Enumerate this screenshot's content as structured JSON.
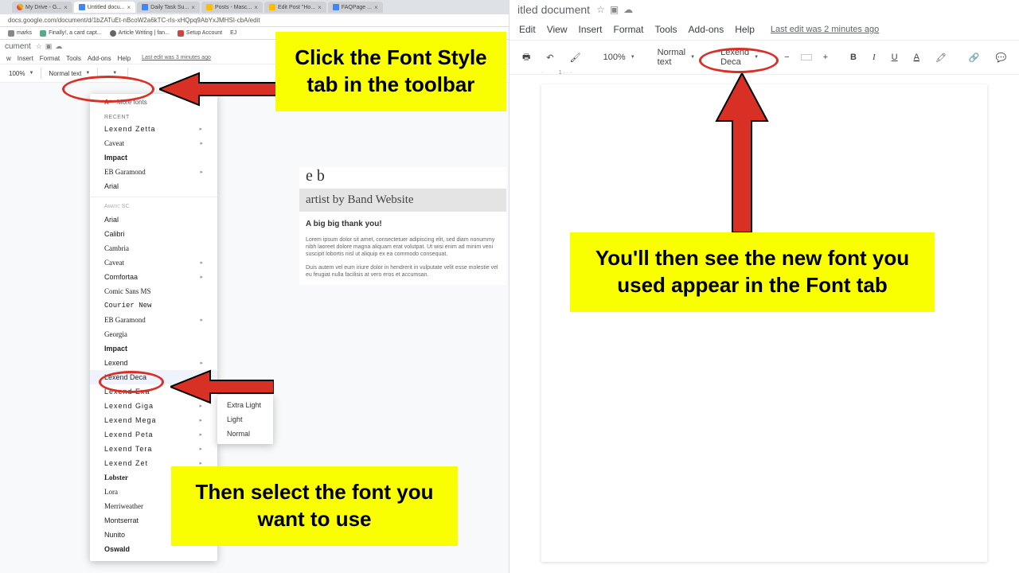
{
  "browser": {
    "tabs": [
      {
        "label": "My Drive - G..."
      },
      {
        "label": "Untitled docu..."
      },
      {
        "label": "Daily Task Su..."
      },
      {
        "label": "Posts - Masc..."
      },
      {
        "label": "Edit Post \"Ho..."
      },
      {
        "label": "FAQPage ..."
      }
    ],
    "url": "docs.google.com/document/d/1bZATuEt-nBcoW2a6kTC-rIs-xHQpq9AbYxJMHSI-cbA/edit",
    "bookmarks": [
      {
        "label": "marks"
      },
      {
        "label": "Finally!, a card capt..."
      },
      {
        "label": "Article Writing | fan..."
      },
      {
        "label": "Setup Account"
      }
    ]
  },
  "left_doc": {
    "title": "cument",
    "menus": [
      "w",
      "Insert",
      "Format",
      "Tools",
      "Add-ons",
      "Help"
    ],
    "last_edit": "Last edit was 3 minutes ago",
    "zoom": "100%",
    "style": "Normal text",
    "font_current": "",
    "more_fonts": "More fonts",
    "recent_label": "RECENT",
    "recent": [
      {
        "name": "Lexend Zetta",
        "cls": "spaced",
        "arrow": true
      },
      {
        "name": "Caveat",
        "cls": "cursive",
        "arrow": true
      },
      {
        "name": "Impact",
        "cls": "bold"
      },
      {
        "name": "EB Garamond",
        "cls": "serif",
        "arrow": true
      },
      {
        "name": "Arial",
        "cls": ""
      }
    ],
    "fonts": [
      {
        "name": "Amatic SC",
        "cls": "small-label"
      },
      {
        "name": "Arial",
        "cls": ""
      },
      {
        "name": "Calibri",
        "cls": ""
      },
      {
        "name": "Cambria",
        "cls": "serif"
      },
      {
        "name": "Caveat",
        "cls": "cursive",
        "arrow": true
      },
      {
        "name": "Comfortaa",
        "cls": "",
        "arrow": true
      },
      {
        "name": "Comic Sans MS",
        "cls": "cursive"
      },
      {
        "name": "Courier New",
        "cls": "mono"
      },
      {
        "name": "EB Garamond",
        "cls": "serif",
        "arrow": true
      },
      {
        "name": "Georgia",
        "cls": "serif"
      },
      {
        "name": "Impact",
        "cls": "bold"
      },
      {
        "name": "Lexend",
        "cls": "",
        "arrow": true
      },
      {
        "name": "Lexend Deca",
        "cls": "",
        "arrow": true,
        "hl": true
      },
      {
        "name": "Lexend Exa",
        "cls": "spaced",
        "arrow": true
      },
      {
        "name": "Lexend Giga",
        "cls": "spaced",
        "arrow": true
      },
      {
        "name": "Lexend Mega",
        "cls": "spaced",
        "arrow": true
      },
      {
        "name": "Lexend Peta",
        "cls": "spaced",
        "arrow": true
      },
      {
        "name": "Lexend Tera",
        "cls": "spaced",
        "arrow": true
      },
      {
        "name": "Lexend Zet",
        "cls": "spaced",
        "arrow": true
      },
      {
        "name": "Lobster",
        "cls": "cursive bold"
      },
      {
        "name": "Lora",
        "cls": "serif"
      },
      {
        "name": "Merriweather",
        "cls": "serif"
      },
      {
        "name": "Montserrat",
        "cls": ""
      },
      {
        "name": "Nunito",
        "cls": ""
      },
      {
        "name": "Oswald",
        "cls": "bold"
      }
    ],
    "weights": [
      "Extra Light",
      "Light",
      "Normal"
    ]
  },
  "doc_content": {
    "hero": "artist by Band Website",
    "thanks": "A big big thank you!",
    "p1": "Lorem ipsum dolor sit amet, consectetuer adipiscing elit, sed diam nonummy nibh laoreet dolore magna aliquam erat volutpat. Ut wisi enim ad minim veni suscipit lobortis nisl ut aliquip ex ea commodo consequat.",
    "p2": "Duis autem vel eum iriure dolor in hendrerit in vulputate velit esse molestie vel eu feugiat nulla facilisis at vero eros et accumsan."
  },
  "right_doc": {
    "title": "itled document",
    "menus": [
      "Edit",
      "View",
      "Insert",
      "Format",
      "Tools",
      "Add-ons",
      "Help"
    ],
    "last_edit": "Last edit was 2 minutes ago",
    "zoom": "100%",
    "style": "Normal text",
    "font_current": "Lexend Deca"
  },
  "callouts": {
    "c1": "Click the Font Style tab in the toolbar",
    "c2": "Then select the font you want to use",
    "c3": "You'll then see the new font you used appear in the Font tab"
  }
}
